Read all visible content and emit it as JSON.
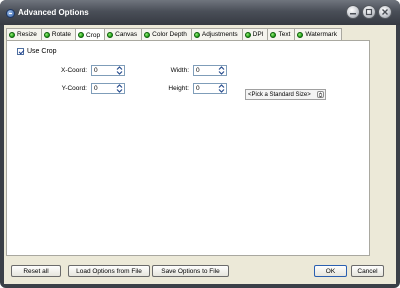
{
  "window": {
    "title": "Advanced Options"
  },
  "tabs": [
    {
      "label": "Resize"
    },
    {
      "label": "Rotate"
    },
    {
      "label": "Crop"
    },
    {
      "label": "Canvas"
    },
    {
      "label": "Color Depth"
    },
    {
      "label": "Adjustments"
    },
    {
      "label": "DPI"
    },
    {
      "label": "Text"
    },
    {
      "label": "Watermark"
    }
  ],
  "active_tab": "Crop",
  "crop": {
    "use_crop_label": "Use Crop",
    "use_crop_checked": true,
    "x_label": "X-Coord:",
    "x_value": "0",
    "y_label": "Y-Coord:",
    "y_value": "0",
    "width_label": "Width:",
    "width_value": "0",
    "height_label": "Height:",
    "height_value": "0",
    "standard_size": "<Pick a Standard Size>"
  },
  "buttons": {
    "reset": "Reset all",
    "load": "Load Options from File",
    "save": "Save Options to File",
    "ok": "OK",
    "cancel": "Cancel"
  },
  "colors": {
    "tab_dot": "#1b9a13",
    "titlebar": "#4a4f58",
    "panel_bg": "#ece9d8"
  }
}
